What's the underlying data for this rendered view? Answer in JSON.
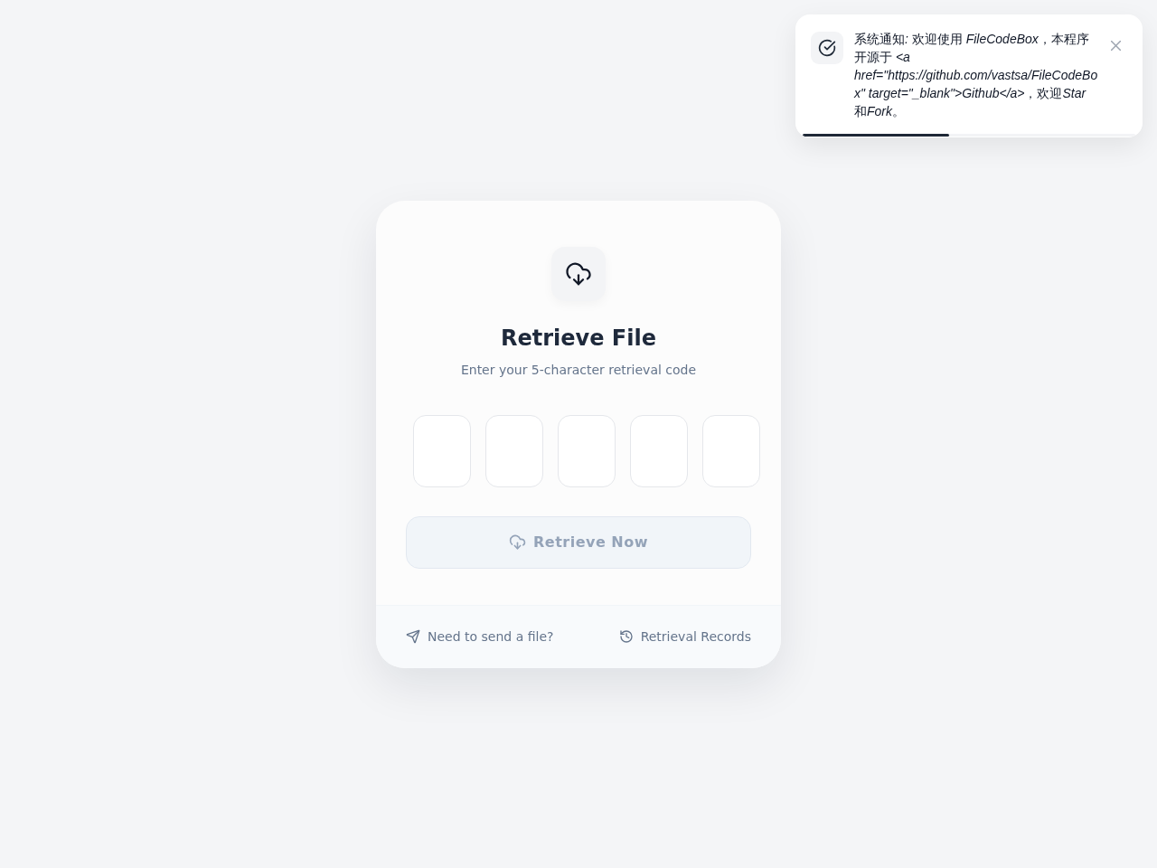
{
  "notification": {
    "message": "系统通知: 欢迎使用 FileCodeBox，本程序开源于 <a href=\"https://github.com/vastsa/FileCodeBox\" target=\"_blank\">Github</a>，欢迎Star和Fork。",
    "progress": {
      "level": 0.44
    }
  },
  "card": {
    "title": "Retrieve File",
    "subtitle": "Enter your 5-character retrieval code",
    "code_inputs": [
      {
        "focused": false
      },
      {
        "focused": false
      },
      {
        "focused": false
      },
      {
        "focused": false
      },
      {
        "focused": false
      }
    ],
    "retrieve_button": {
      "label": "Retrieve Now",
      "disabled": true
    },
    "footer_links": [
      {
        "label": "Need to send a file?",
        "kind": "send"
      },
      {
        "label": "Retrieval Records",
        "kind": "history"
      }
    ]
  }
}
